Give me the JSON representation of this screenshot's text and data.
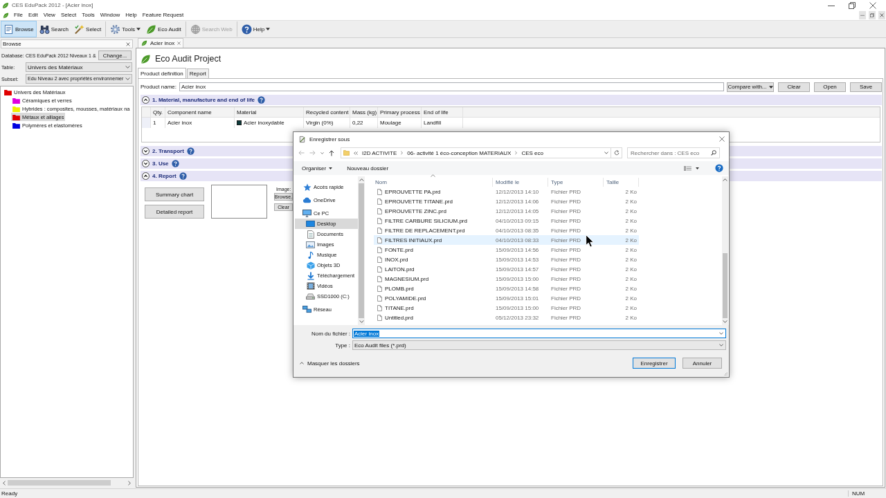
{
  "window": {
    "title": "CES EduPack 2012 - [Acier inox]"
  },
  "menu": [
    "File",
    "Edit",
    "View",
    "Select",
    "Tools",
    "Window",
    "Help",
    "Feature Request"
  ],
  "toolbar": [
    [
      {
        "label": "Browse",
        "selected": true,
        "disabled": false,
        "dropdown": false
      },
      {
        "label": "Search",
        "selected": false,
        "disabled": false,
        "dropdown": false
      },
      {
        "label": "Select",
        "selected": false,
        "disabled": false,
        "dropdown": false
      }
    ],
    [
      {
        "label": "Tools",
        "selected": false,
        "disabled": false,
        "dropdown": true
      },
      {
        "label": "Eco Audit",
        "selected": false,
        "disabled": false,
        "dropdown": false
      }
    ],
    [
      {
        "label": "Search Web",
        "selected": false,
        "disabled": true,
        "dropdown": false
      }
    ],
    [
      {
        "label": "Help",
        "selected": false,
        "disabled": false,
        "dropdown": true
      }
    ]
  ],
  "browse_panel": {
    "title": "Browse",
    "database_label": "Database:",
    "database": "CES EduPack 2012 Niveaux 1 &",
    "change_button": "Change...",
    "table_label": "Table:",
    "table": "Univers des Matériaux",
    "subset_label": "Subset:",
    "subset": "Edu Niveau 2 avec propriétés environnemer",
    "tree": [
      {
        "label": "Univers des Matériaux",
        "color": "#e00000",
        "selected": false,
        "children": [
          {
            "label": "Céramiques et verres",
            "color": "#e000e0",
            "selected": false
          },
          {
            "label": "Hybrides : composites, mousses, matériaux na",
            "color": "#f0f000",
            "selected": false
          },
          {
            "label": "Métaux et alliages",
            "color": "#e00000",
            "selected": true
          },
          {
            "label": "Polymères et elastomères",
            "color": "#0000e0",
            "selected": false
          }
        ]
      }
    ]
  },
  "document_tab": {
    "label": "Acier inox"
  },
  "project": {
    "title": "Eco Audit Project",
    "tabs": [
      {
        "label": "Product definition",
        "selected": true
      },
      {
        "label": "Report",
        "selected": false
      }
    ],
    "product_name_label": "Product name:",
    "product_name": "Acier inox",
    "compare_button": "Compare with...",
    "buttons": [
      "Clear",
      "Open",
      "Save"
    ],
    "sections": [
      {
        "title": "1. Material, manufacture and end of life",
        "expanded": true,
        "table": {
          "columns": [
            "Qty.",
            "Component name",
            "Material",
            "Recycled content",
            "Mass (kg)",
            "Primary process",
            "End of life"
          ],
          "rows": [
            {
              "cells": [
                "1",
                "Acier inox",
                "Acier inoxydable",
                "Virgin (0%)",
                "0,22",
                "Moulage",
                "Landfill"
              ]
            }
          ]
        }
      },
      {
        "title": "2. Transport",
        "expanded": false
      },
      {
        "title": "3. Use",
        "expanded": false
      },
      {
        "title": "4. Report",
        "expanded": true,
        "report": {
          "buttons": [
            "Summary chart",
            "Detailed report"
          ],
          "image_label": "Image:",
          "image_buttons": [
            "Browse.",
            "Clear"
          ]
        }
      }
    ]
  },
  "save_dialog": {
    "title": "Enregistrer sous",
    "path": [
      "I2D ACTIVITE",
      "06- activité 1 éco-conception MATERIAUX",
      "CES eco"
    ],
    "search_placeholder": "Rechercher dans : CES eco",
    "toolbar": [
      {
        "label": "Organiser",
        "dropdown": true
      },
      {
        "label": "Nouveau dossier",
        "dropdown": false
      }
    ],
    "navigation": [
      {
        "label": "Accès rapide",
        "selected": false
      },
      {
        "label": "OneDrive",
        "selected": false
      },
      {
        "label": "Ce PC",
        "selected": false,
        "children": [
          {
            "label": "Desktop",
            "selected": true
          },
          {
            "label": "Documents",
            "selected": false
          },
          {
            "label": "Images",
            "selected": false
          },
          {
            "label": "Musique",
            "selected": false
          },
          {
            "label": "Objets 3D",
            "selected": false
          },
          {
            "label": "Téléchargement",
            "selected": false
          },
          {
            "label": "Vidéos",
            "selected": false
          },
          {
            "label": "SSD1000 (C:)",
            "selected": false
          }
        ]
      },
      {
        "label": "Réseau",
        "selected": false
      }
    ],
    "columns": [
      {
        "label": "Nom",
        "sorted": true
      },
      {
        "label": "Modifié le",
        "sorted": false
      },
      {
        "label": "Type",
        "sorted": false
      },
      {
        "label": "Taille",
        "sorted": false
      }
    ],
    "files": [
      {
        "name": "EPROUVETTE PA.prd",
        "modified": "12/12/2013 14:10",
        "type": "Fichier PRD",
        "size": "2 Ko",
        "hovered": false
      },
      {
        "name": "EPROUVETTE TITANE.prd",
        "modified": "12/12/2013 14:06",
        "type": "Fichier PRD",
        "size": "2 Ko",
        "hovered": false
      },
      {
        "name": "EPROUVETTE ZINC.prd",
        "modified": "12/12/2013 14:05",
        "type": "Fichier PRD",
        "size": "2 Ko",
        "hovered": false
      },
      {
        "name": "FILTRE CARBURE SILICIUM.prd",
        "modified": "04/10/2013 09:15",
        "type": "Fichier PRD",
        "size": "2 Ko",
        "hovered": false
      },
      {
        "name": "FILTRE DE REPLACEMENT.prd",
        "modified": "04/10/2013 08:35",
        "type": "Fichier PRD",
        "size": "2 Ko",
        "hovered": false
      },
      {
        "name": "FILTRES INITIAUX.prd",
        "modified": "04/10/2013 08:33",
        "type": "Fichier PRD",
        "size": "2 Ko",
        "hovered": true
      },
      {
        "name": "FONTE.prd",
        "modified": "15/09/2013 14:56",
        "type": "Fichier PRD",
        "size": "2 Ko",
        "hovered": false
      },
      {
        "name": "INOX.prd",
        "modified": "15/09/2013 14:53",
        "type": "Fichier PRD",
        "size": "2 Ko",
        "hovered": false
      },
      {
        "name": "LAITON.prd",
        "modified": "15/09/2013 14:57",
        "type": "Fichier PRD",
        "size": "2 Ko",
        "hovered": false
      },
      {
        "name": "MAGNESIUM.prd",
        "modified": "15/09/2013 15:00",
        "type": "Fichier PRD",
        "size": "2 Ko",
        "hovered": false
      },
      {
        "name": "PLOMB.prd",
        "modified": "15/09/2013 14:58",
        "type": "Fichier PRD",
        "size": "2 Ko",
        "hovered": false
      },
      {
        "name": "POLYAMIDE.prd",
        "modified": "15/09/2013 15:01",
        "type": "Fichier PRD",
        "size": "2 Ko",
        "hovered": false
      },
      {
        "name": "TITANE.prd",
        "modified": "15/09/2013 15:00",
        "type": "Fichier PRD",
        "size": "2 Ko",
        "hovered": false
      },
      {
        "name": "Untitled.prd",
        "modified": "05/12/2013 23:32",
        "type": "Fichier PRD",
        "size": "2 Ko",
        "hovered": false
      }
    ],
    "filename_label": "Nom du fichier :",
    "filename": "Acier inox",
    "filename_selected": true,
    "type_label": "Type :",
    "file_type": "Eco Audit files (*.prd)",
    "hide_folders": "Masquer les dossiers",
    "buttons": [
      {
        "label": "Enregistrer",
        "default": true
      },
      {
        "label": "Annuler",
        "default": false
      }
    ]
  },
  "status_bar": {
    "text": "Ready",
    "indicator": "NUM"
  }
}
